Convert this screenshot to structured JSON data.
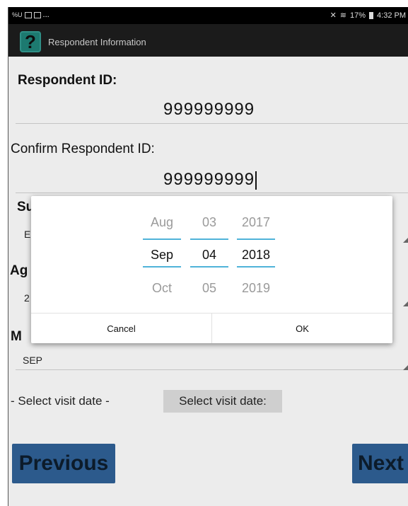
{
  "status_bar": {
    "left_text": "%U",
    "ellipsis": "...",
    "battery": "17%",
    "time": "4:32 PM"
  },
  "app_bar": {
    "icon_glyph": "?",
    "title": "Respondent Information"
  },
  "form": {
    "respondent_id_label": "Respondent ID:",
    "respondent_id_value": "999999999",
    "confirm_id_label": "Confirm Respondent ID:",
    "confirm_id_value": "999999999",
    "partial_label_1": "Su",
    "partial_value_1": "E",
    "partial_label_2": "Ag",
    "partial_value_2": "2",
    "partial_label_3": "M",
    "month_value": "SEP",
    "select_visit_date_text": "- Select visit date -",
    "select_visit_date_button": "Select visit date:"
  },
  "nav": {
    "previous": "Previous",
    "next": "Next"
  },
  "date_picker": {
    "months": [
      "Aug",
      "Sep",
      "Oct"
    ],
    "days": [
      "03",
      "04",
      "05"
    ],
    "years": [
      "2017",
      "2018",
      "2019"
    ],
    "selected": {
      "month": "Sep",
      "day": "04",
      "year": "2018"
    },
    "accent_color": "#4fb3d9",
    "cancel": "Cancel",
    "ok": "OK"
  }
}
